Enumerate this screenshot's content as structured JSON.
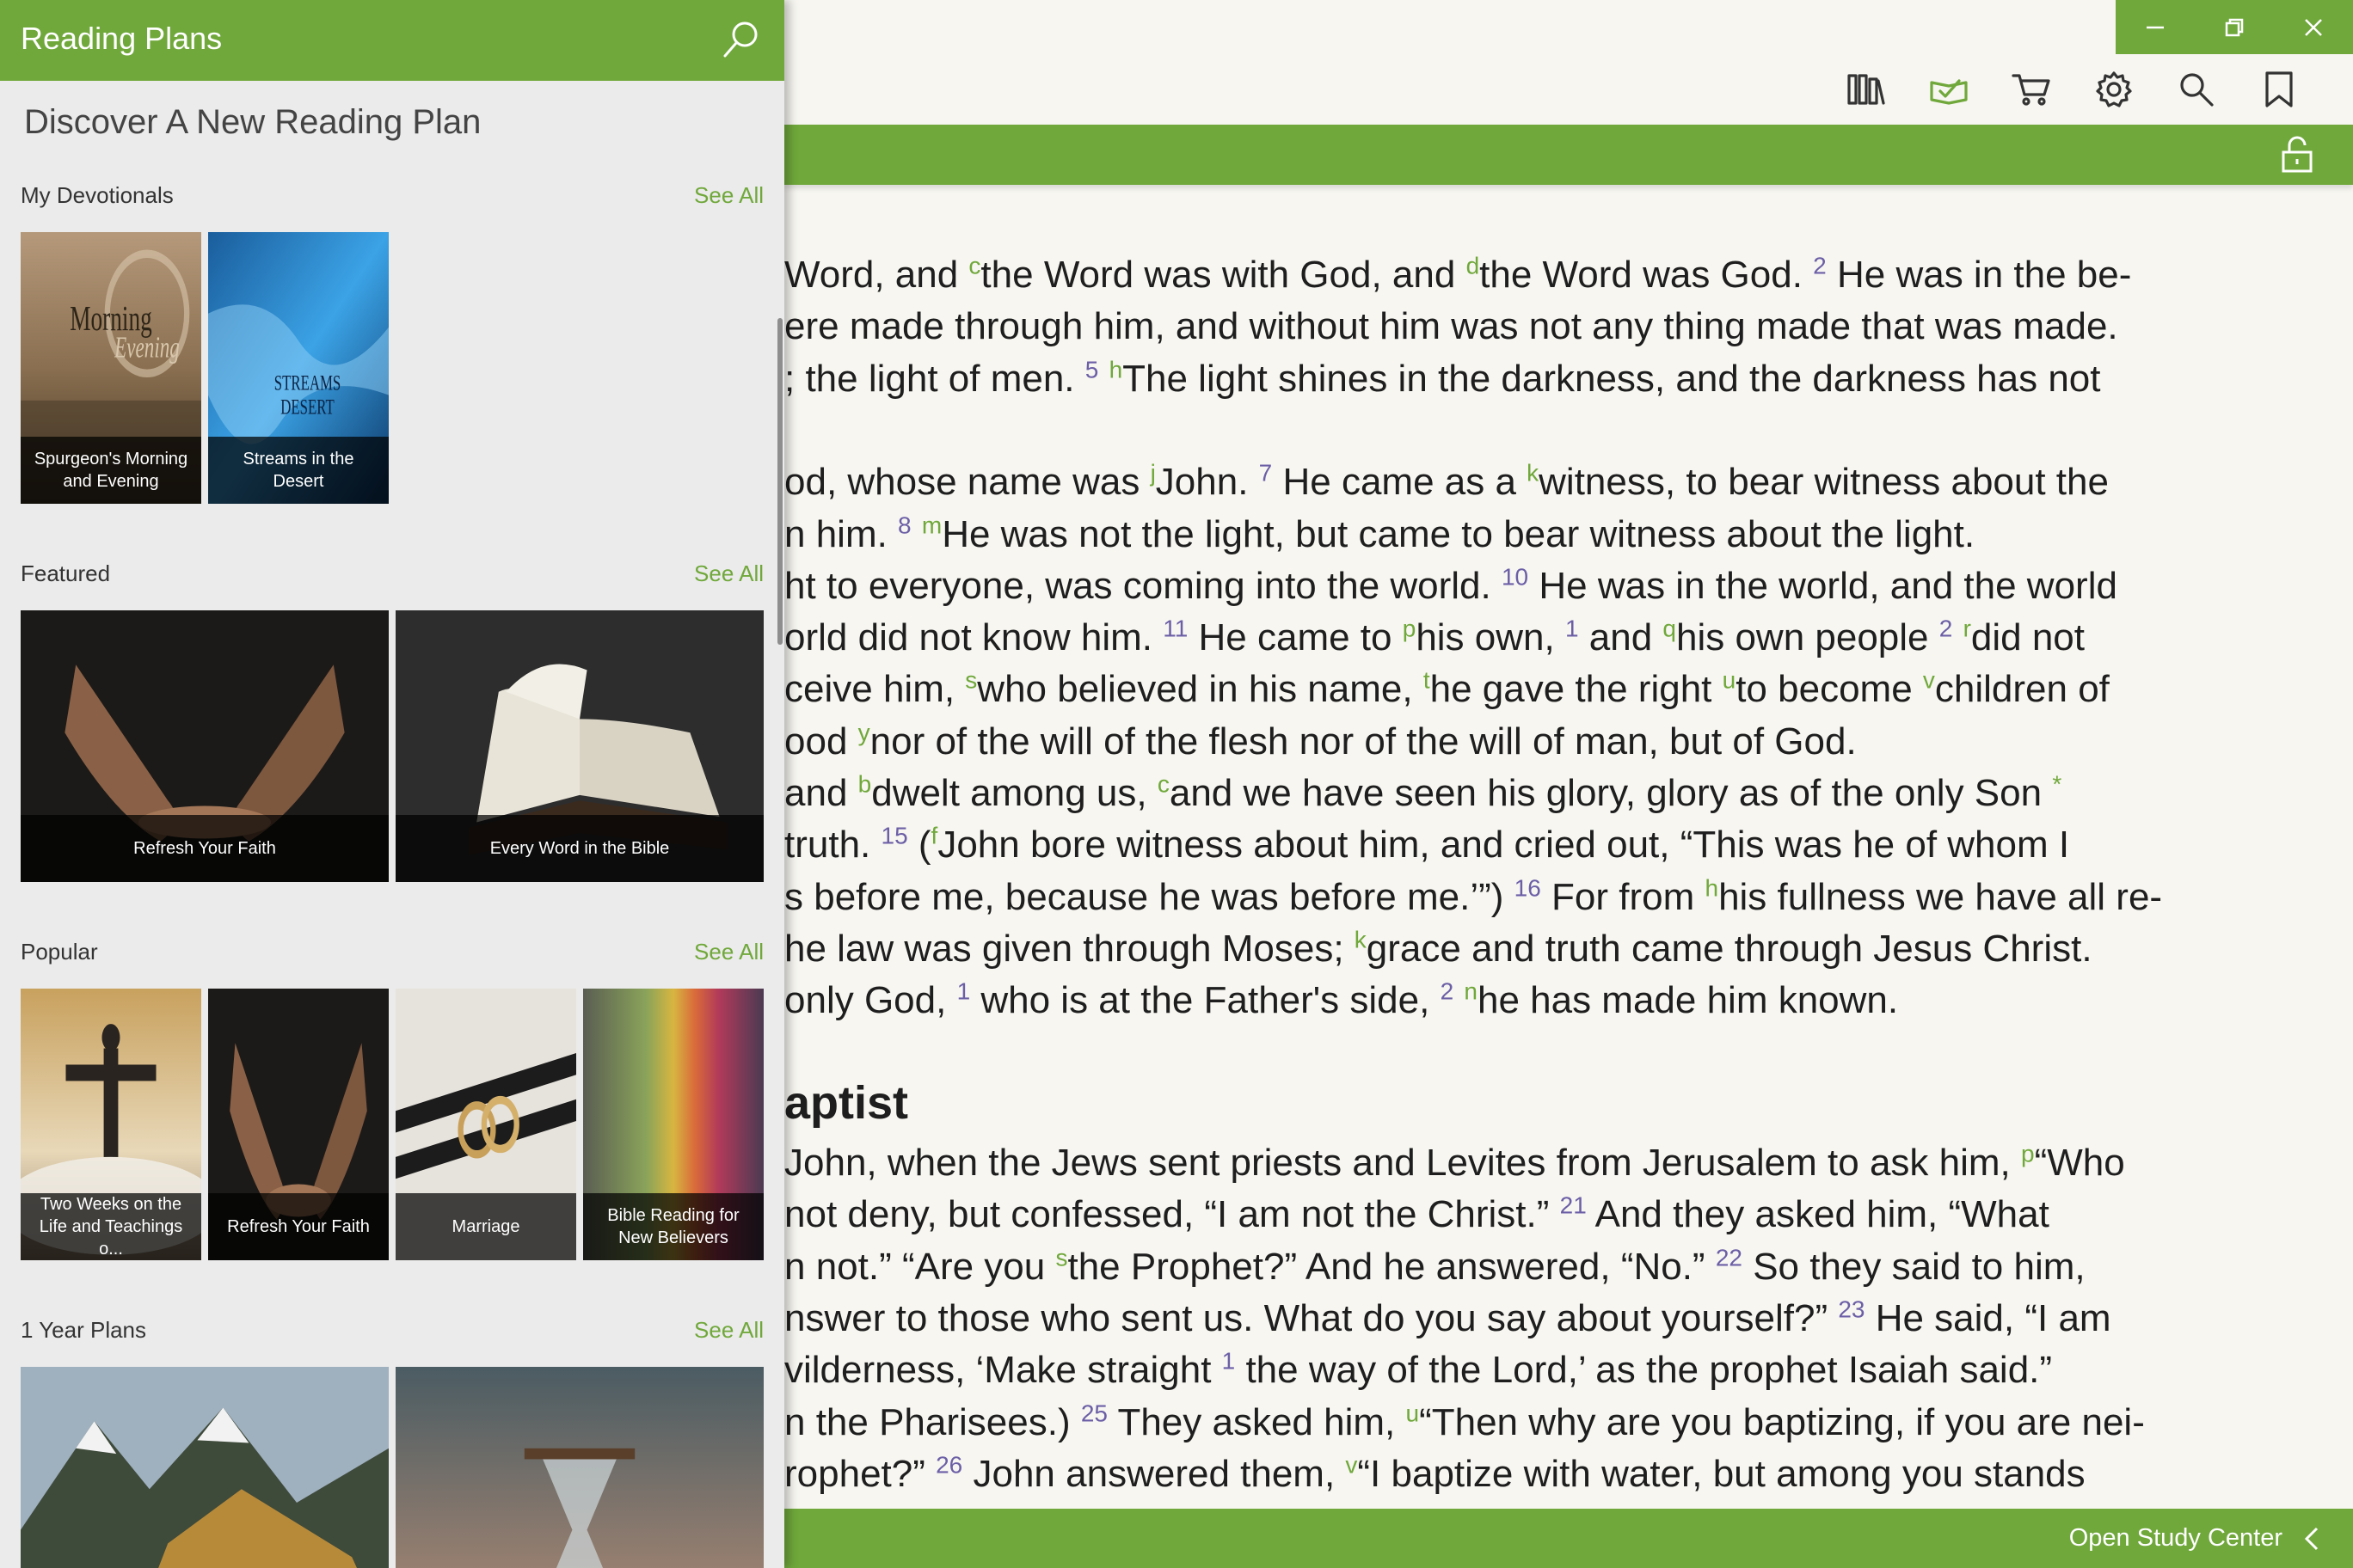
{
  "window_controls": {
    "minimize": "minimize",
    "restore": "restore",
    "close": "close"
  },
  "toolbar": {
    "icons": [
      "library-icon",
      "reading-plans-icon",
      "cart-icon",
      "settings-icon",
      "search-icon",
      "bookmark-icon"
    ],
    "active": "reading-plans-icon"
  },
  "colors": {
    "accent": "#70a83b",
    "verse_number": "#6c5fa6",
    "text": "#1e1e1e",
    "panel_bg": "#ebebeb"
  },
  "reading": {
    "lines": [
      {
        "html": "Word, and <sup class='f'>c</sup>the Word was with God, and <sup class='f'>d</sup>the Word was God. <sup class='n'>2</sup> He was in the be-"
      },
      {
        "html": "ere made through him, and without him was not any thing made that was made."
      },
      {
        "html": "; the light of men. <sup class='n'>5</sup> <sup class='f'>h</sup>The light shines in the darkness, and the darkness has not"
      },
      {
        "html": ""
      },
      {
        "html": "od, whose name was <sup class='f'>j</sup>John. <sup class='n'>7</sup> He came as a <sup class='f'>k</sup>witness, to bear witness about the"
      },
      {
        "html": "n him. <sup class='n'>8</sup> <sup class='f'>m</sup>He was not the light, but came to bear witness about the light."
      },
      {
        "html": "ht to everyone, was coming into the world. <sup class='n'>10</sup> He was in the world, and the world"
      },
      {
        "html": "orld did not know him. <sup class='n'>11</sup> He came to <sup class='f'>p</sup>his own, <sup class='n'>1</sup> and <sup class='f'>q</sup>his own people <sup class='n'>2</sup> <sup class='f'>r</sup>did not"
      },
      {
        "html": "ceive him, <sup class='f'>s</sup>who believed in his name, <sup class='f'>t</sup>he gave the right <sup class='f'>u</sup>to become <sup class='f'>v</sup>children of"
      },
      {
        "html": "ood <sup class='f'>y</sup>nor of the will of the flesh nor of the will of man, but of God."
      },
      {
        "html": " and <sup class='f'>b</sup>dwelt among us, <sup class='f'>c</sup>and we have seen his glory, glory as of the only Son <sup class='f'>*</sup>"
      },
      {
        "html": "truth. <sup class='n'>15</sup> (<sup class='f'>f</sup>John bore witness about him, and cried out, “This was he of whom I"
      },
      {
        "html": "s before me, because he was before me.’”) <sup class='n'>16</sup> For from <sup class='f'>h</sup>his fullness we have all re-"
      },
      {
        "html": "he law was given through Moses; <sup class='f'>k</sup>grace and truth came through Jesus Christ."
      },
      {
        "html": "only God, <sup class='n'>1</sup> who is at the Father's side, <sup class='n'>2</sup> <sup class='f'>n</sup>he has made him known."
      }
    ],
    "heading": "aptist",
    "lines2": [
      {
        "html": "John, when the Jews sent priests and Levites from Jerusalem to ask him, <sup class='f'>p</sup>“Who"
      },
      {
        "html": " not deny, but confessed, “I am not the Christ.” <sup class='n'>21</sup> And they asked him, “What"
      },
      {
        "html": "n not.” “Are you <sup class='f'>s</sup>the Prophet?” And he answered, “No.” <sup class='n'>22</sup> So they said to him,"
      },
      {
        "html": "nswer to those who sent us. What do you say about yourself?” <sup class='n'>23</sup> He said, “I am"
      },
      {
        "html": "vilderness, ‘Make straight <sup class='n'>1</sup> the way of the Lord,’ as the prophet Isaiah said.”"
      },
      {
        "html": "n the Pharisees.) <sup class='n'>25</sup> They asked him, <sup class='f'>u</sup>“Then why are you baptizing, if you are nei-"
      },
      {
        "html": "rophet?” <sup class='n'>26</sup> John answered them, <sup class='f'>v</sup>“I baptize with water, but among you stands"
      }
    ]
  },
  "bottom_bar": {
    "label": "Open Study Center"
  },
  "panel": {
    "title": "Reading Plans",
    "subtitle": "Discover A New Reading Plan",
    "sections": [
      {
        "title": "My Devotionals",
        "see_all": "See All",
        "tiles": [
          {
            "caption": "Spurgeon's Morning and Evening",
            "art": "morning-evening"
          },
          {
            "caption": "Streams in the Desert",
            "art": "streams"
          }
        ]
      },
      {
        "title": "Featured",
        "see_all": "See All",
        "tiles": [
          {
            "caption": "Refresh Your Faith",
            "art": "hands"
          },
          {
            "caption": "Every Word in the Bible",
            "art": "bible"
          }
        ]
      },
      {
        "title": "Popular",
        "see_all": "See All",
        "tiles": [
          {
            "caption": "Two Weeks on the Life and Teachings o...",
            "art": "christ"
          },
          {
            "caption": "Refresh Your Faith",
            "art": "hands"
          },
          {
            "caption": "Marriage",
            "art": "rings"
          },
          {
            "caption": "Bible Reading for New Believers",
            "art": "rainbow"
          }
        ]
      },
      {
        "title": "1 Year Plans",
        "see_all": "See All",
        "tiles": [
          {
            "caption": "",
            "art": "mountains"
          },
          {
            "caption": "",
            "art": "hourglass"
          }
        ]
      }
    ]
  }
}
